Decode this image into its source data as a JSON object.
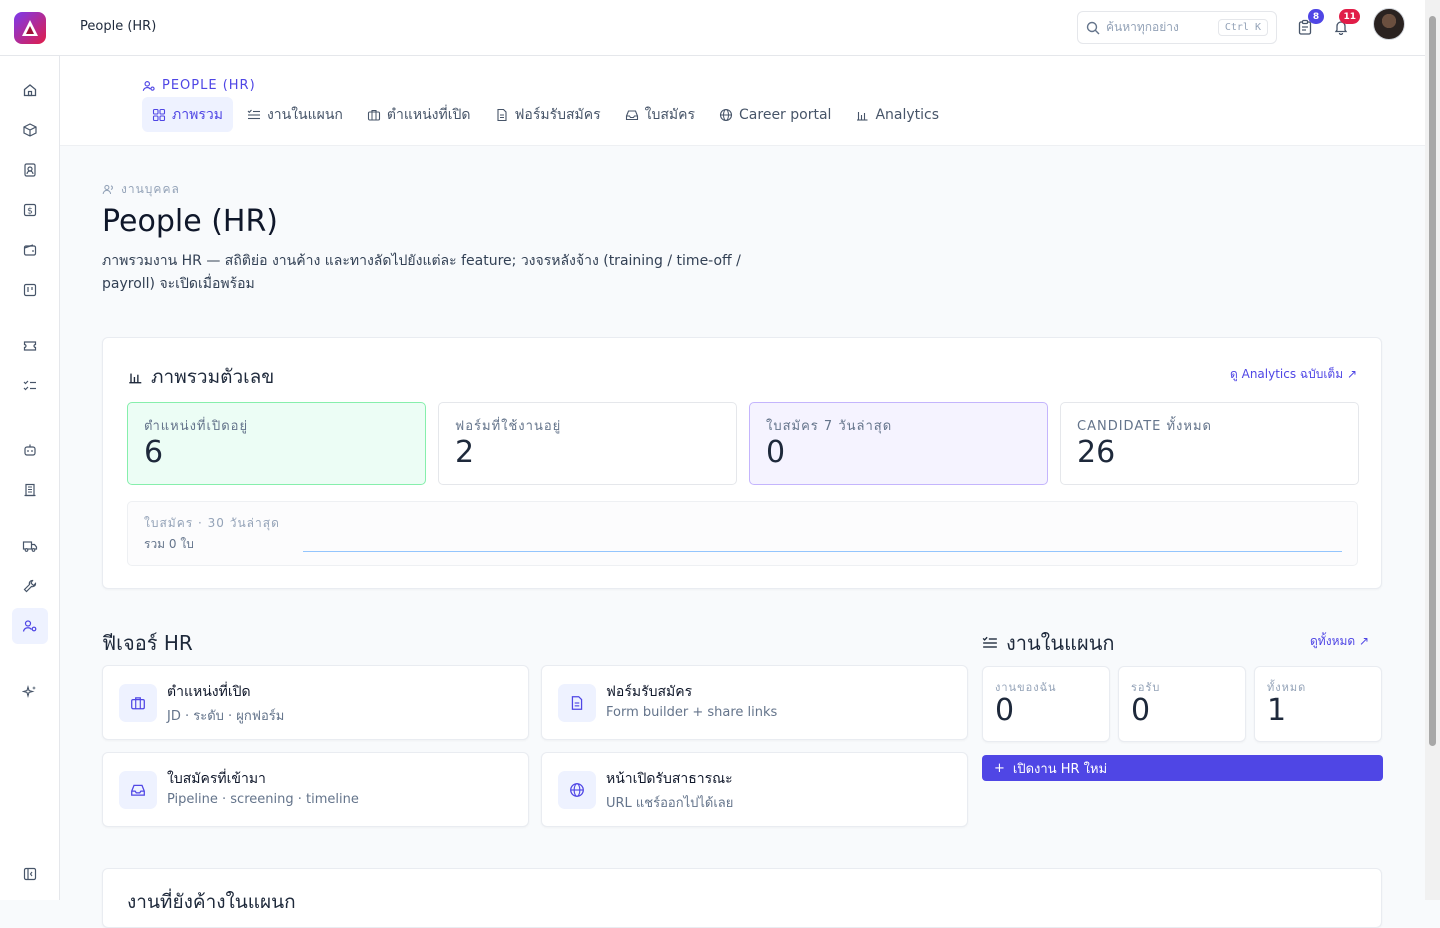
{
  "header": {
    "title": "People (HR)",
    "search_placeholder": "ค้นหาทุกอย่าง",
    "search_shortcut": "Ctrl K",
    "tasks_badge": "8",
    "notifications_badge": "11"
  },
  "subnav": {
    "section": "PEOPLE (HR)",
    "tabs": [
      {
        "label": "ภาพรวม",
        "icon": "grid-icon"
      },
      {
        "label": "งานในแผนก",
        "icon": "list-check-icon"
      },
      {
        "label": "ตำแหน่งที่เปิด",
        "icon": "briefcase-icon"
      },
      {
        "label": "ฟอร์มรับสมัคร",
        "icon": "file-text-icon"
      },
      {
        "label": "ใบสมัคร",
        "icon": "inbox-icon"
      },
      {
        "label": "Career portal",
        "icon": "globe-icon"
      },
      {
        "label": "Analytics",
        "icon": "bar-chart-icon"
      }
    ]
  },
  "page": {
    "breadcrumb": "งานบุคคล",
    "title": "People (HR)",
    "description": "ภาพรวมงาน HR — สถิติย่อ งานค้าง และทางลัดไปยังแต่ละ feature; วงจรหลังจ้าง (training / time-off / payroll) จะเปิดเมื่อพร้อม"
  },
  "overview": {
    "title": "ภาพรวมตัวเลข",
    "link": "ดู Analytics ฉบับเต็ม ↗",
    "stats": [
      {
        "label": "ตำแหน่งที่เปิดอยู่",
        "value": "6"
      },
      {
        "label": "ฟอร์มที่ใช้งานอยู่",
        "value": "2"
      },
      {
        "label": "ใบสมัคร 7 วันล่าสุด",
        "value": "0"
      },
      {
        "label": "CANDIDATE ทั้งหมด",
        "value": "26"
      }
    ],
    "spark_label": "ใบสมัคร · 30 วันล่าสุด",
    "spark_total": "รวม 0 ใบ"
  },
  "features": {
    "title": "ฟีเจอร์ HR",
    "items": [
      {
        "title": "ตำแหน่งที่เปิด",
        "subtitle": "JD · ระดับ · ผูกฟอร์ม",
        "icon": "briefcase-icon"
      },
      {
        "title": "ฟอร์มรับสมัคร",
        "subtitle": "Form builder + share links",
        "icon": "file-text-icon"
      },
      {
        "title": "ใบสมัครที่เข้ามา",
        "subtitle": "Pipeline · screening · timeline",
        "icon": "inbox-icon"
      },
      {
        "title": "หน้าเปิดรับสาธารณะ",
        "subtitle": "URL แชร์ออกไปได้เลย",
        "icon": "globe-icon"
      }
    ]
  },
  "dept": {
    "title": "งานในแผนก",
    "link": "ดูทั้งหมด ↗",
    "stats": [
      {
        "label": "งานของฉัน",
        "value": "0"
      },
      {
        "label": "รอรับ",
        "value": "0"
      },
      {
        "label": "ทั้งหมด",
        "value": "1"
      }
    ],
    "new_button": "เปิดงาน HR ใหม่"
  },
  "bottom": {
    "title": "งานที่ยังค้างในแผนก"
  },
  "colors": {
    "accent": "#4f46e5",
    "brand_start": "#7c3aed",
    "brand_end": "#e11d48",
    "badge": "#4f46e5",
    "badge_alert": "#e11d48"
  }
}
